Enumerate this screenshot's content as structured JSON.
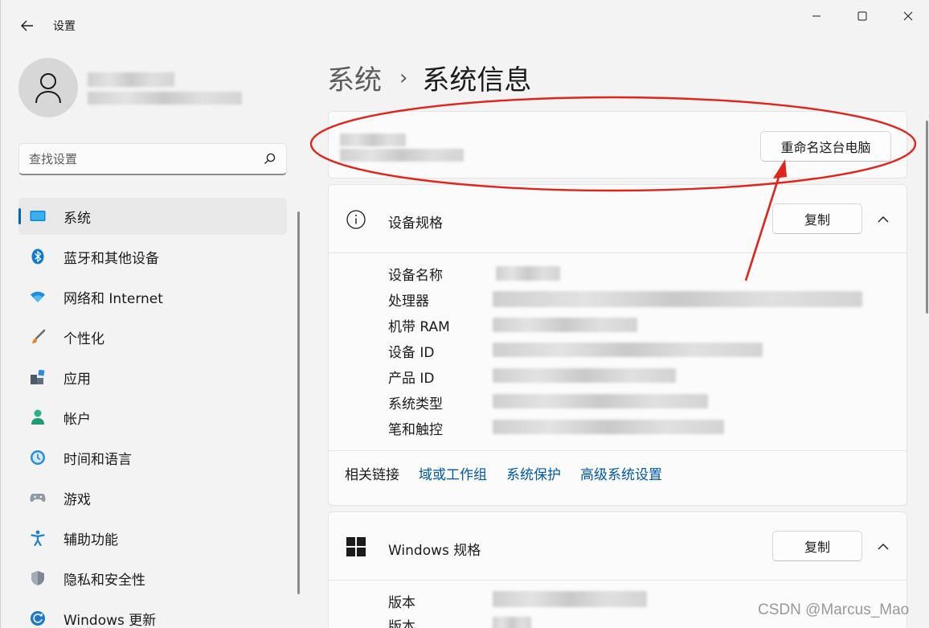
{
  "window": {
    "app_title": "设置",
    "colors": {
      "accent": "#0067c0",
      "link": "#0058a8",
      "annotation": "#e0241c"
    }
  },
  "sidebar": {
    "search_placeholder": "查找设置",
    "items": [
      {
        "label": "系统",
        "icon": "system-display-icon",
        "active": true
      },
      {
        "label": "蓝牙和其他设备",
        "icon": "bluetooth-icon"
      },
      {
        "label": "网络和 Internet",
        "icon": "wifi-icon"
      },
      {
        "label": "个性化",
        "icon": "brush-icon"
      },
      {
        "label": "应用",
        "icon": "apps-icon"
      },
      {
        "label": "帐户",
        "icon": "account-icon"
      },
      {
        "label": "时间和语言",
        "icon": "time-language-icon"
      },
      {
        "label": "游戏",
        "icon": "gamepad-icon"
      },
      {
        "label": "辅助功能",
        "icon": "accessibility-icon"
      },
      {
        "label": "隐私和安全性",
        "icon": "shield-icon"
      },
      {
        "label": "Windows 更新",
        "icon": "windows-update-icon"
      }
    ]
  },
  "main": {
    "breadcrumb": {
      "parent": "系统",
      "separator": "›",
      "current": "系统信息"
    },
    "rename_button": "重命名这台电脑",
    "device_specs": {
      "title": "设备规格",
      "copy_button": "复制",
      "rows": [
        "设备名称",
        "处理器",
        "机带 RAM",
        "设备 ID",
        "产品 ID",
        "系统类型",
        "笔和触控"
      ]
    },
    "related_links": {
      "label": "相关链接",
      "links": [
        "域或工作组",
        "系统保护",
        "高级系统设置"
      ]
    },
    "windows_specs": {
      "title": "Windows 规格",
      "copy_button": "复制",
      "rows": [
        "版本",
        "版本"
      ]
    }
  },
  "watermark": "CSDN @Marcus_Mao"
}
